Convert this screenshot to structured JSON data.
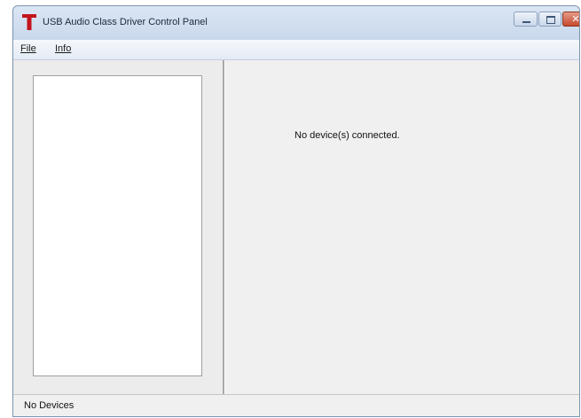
{
  "window": {
    "title": "USB Audio Class Driver Control Panel",
    "icon": "t-logo-icon",
    "controls": {
      "minimize_icon": "minimize-icon",
      "maximize_icon": "maximize-icon",
      "close_icon": "close-icon",
      "close_glyph": "✕"
    }
  },
  "menu": {
    "file": "File",
    "info": "Info"
  },
  "main": {
    "message": "No device(s) connected."
  },
  "status": {
    "text": "No Devices"
  },
  "colors": {
    "logo": "#c4131b",
    "close_button": "#c8492e",
    "titlebar": "#cfdcec"
  }
}
